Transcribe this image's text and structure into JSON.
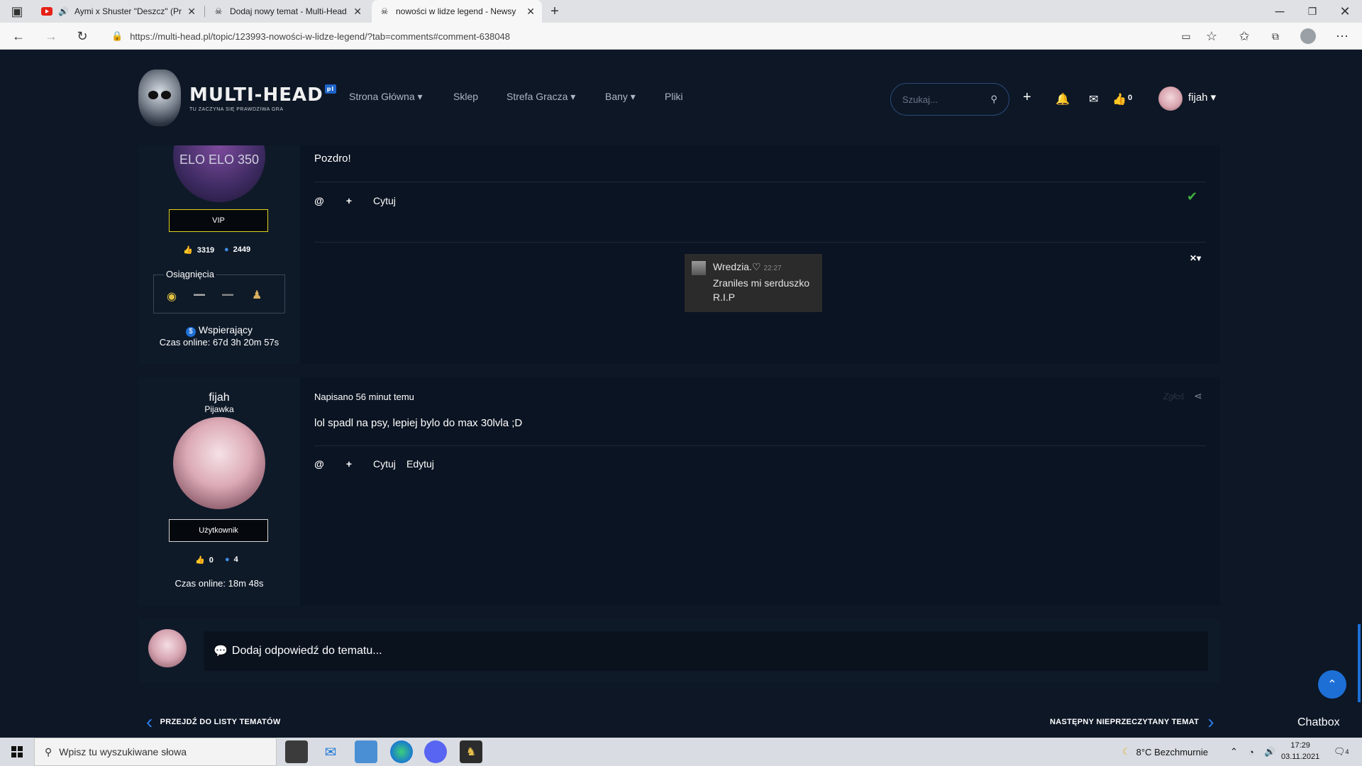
{
  "browser": {
    "tabs": [
      {
        "title": "Aymi x Shuster \"Deszcz\" (Pr",
        "favicon": "youtube-icon"
      },
      {
        "title": "Dodaj nowy temat - Multi-Head.",
        "favicon": "multihead-icon"
      },
      {
        "title": "nowości w lidze legend - Newsy",
        "favicon": "multihead-icon"
      }
    ],
    "url": "https://multi-head.pl/topic/123993-nowości-w-lidze-legend/?tab=comments#comment-638048"
  },
  "site": {
    "logo_text": "MULTI-HEAD",
    "logo_badge": "pl",
    "logo_tagline": "TU ZACZYNA SIĘ PRAWDZIWA GRA",
    "nav": [
      "Strona Główna ▾",
      "Sklep",
      "Strefa Gracza ▾",
      "Bany ▾",
      "Pliki"
    ],
    "search_placeholder": "Szukaj...",
    "reaction_count": "0",
    "username": "fijah ▾"
  },
  "post1": {
    "avatar_text": "ELO ELO 350",
    "rank": "VIP",
    "likes": "3319",
    "posts": "2449",
    "achievements_label": "Osiągnięcia",
    "badge_label": "Wspierający",
    "online": "Czas online: 67d 3h 20m 57s",
    "text": "Pozdro!",
    "quote_label": "Cytuj",
    "chat": {
      "author": "Wredzia.♡",
      "time": "22:27",
      "line1": "Zraniles mi serduszko",
      "line2": "R.I.P"
    }
  },
  "post2": {
    "username": "fijah",
    "title": "Pijawka",
    "rank": "Użytkownik",
    "likes": "0",
    "posts": "4",
    "online": "Czas online: 18m 48s",
    "date": "Napisano 56 minut temu",
    "report": "Zgłoś",
    "text": "lol spadl na psy, lepiej bylo do max 30lvla ;D",
    "quote_label": "Cytuj",
    "edit_label": "Edytuj"
  },
  "reply": {
    "placeholder": "Dodaj odpowiedź do tematu..."
  },
  "pager": {
    "prev": "PRZEJDŹ DO LISTY TEMATÓW",
    "next": "NASTĘPNY NIEPRZECZYTANY TEMAT"
  },
  "chatbox": "Chatbox",
  "taskbar": {
    "search": "Wpisz tu wyszukiwane słowa",
    "weather": "8°C  Bezchmurnie",
    "time": "17:29",
    "date": "03.11.2021",
    "notifications": "4"
  },
  "colors": {
    "accent": "#1d6fd6",
    "background": "#0d1726",
    "vip": "#e0d21a",
    "like": "#3fb23f"
  }
}
